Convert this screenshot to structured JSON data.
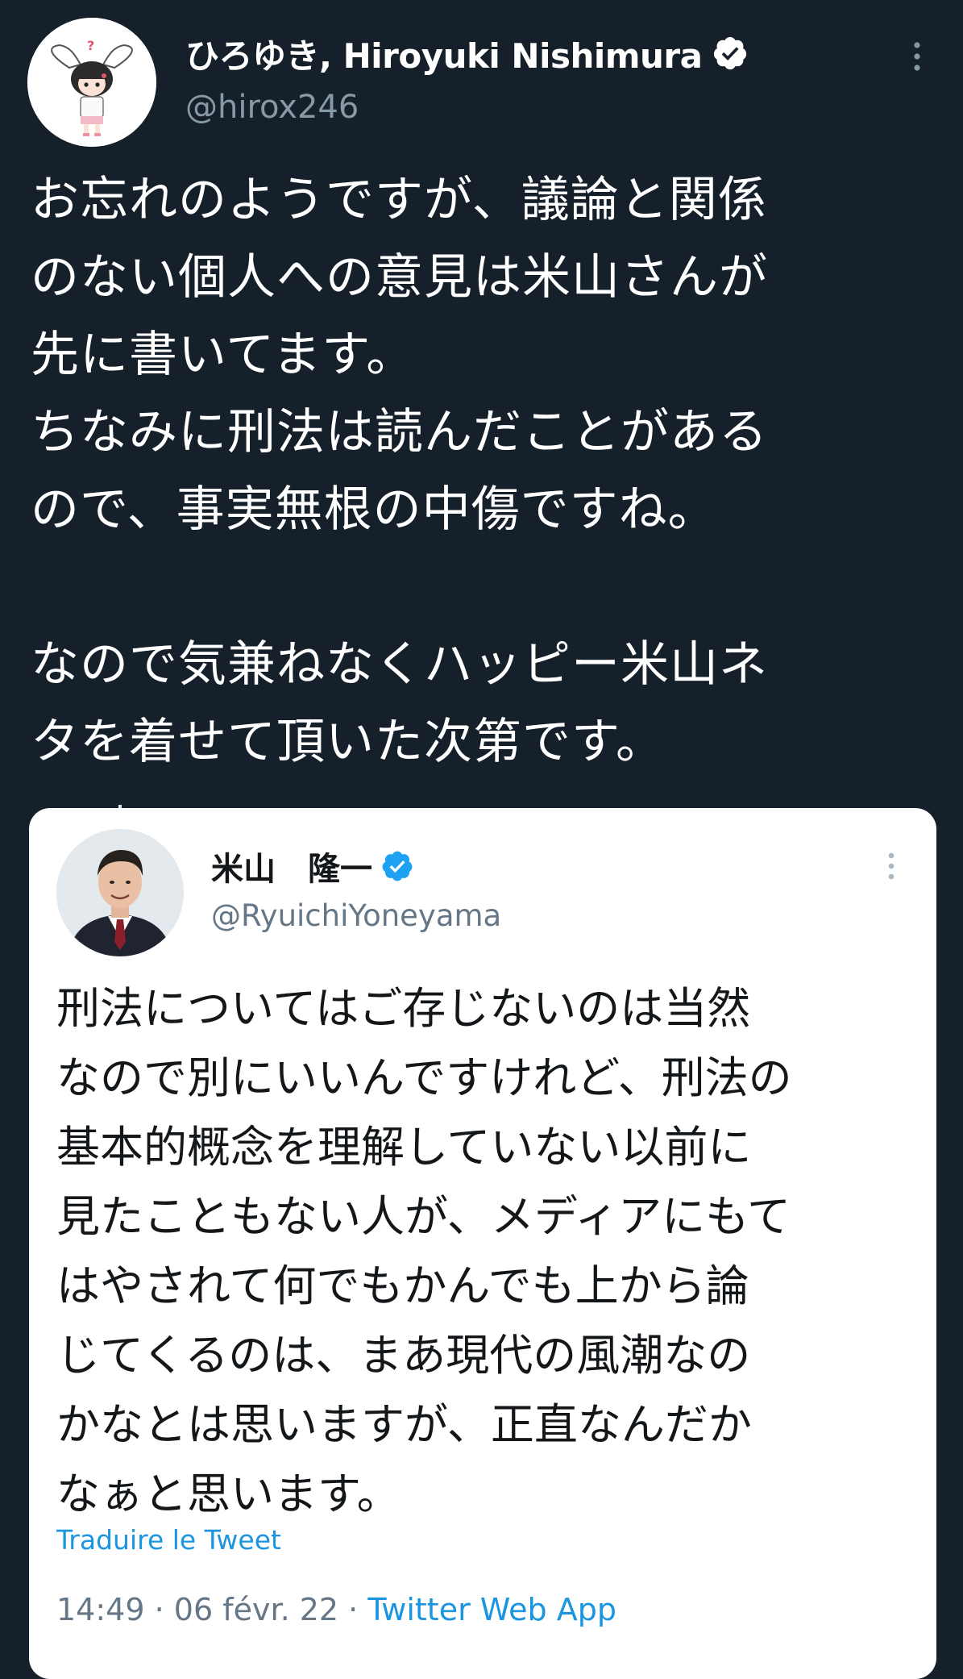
{
  "main_tweet": {
    "display_name": "ひろゆき, Hiroyuki Nishimura",
    "handle": "@hirox246",
    "text_lines": [
      "お忘れのようですが、議論と関係",
      "のない個人への意見は米山さんが",
      "先に書いてます。",
      "ちなみに刑法は読んだことがある",
      "ので、事実無根の中傷ですね。",
      "",
      "なので気兼ねなくハッピー米山ネ",
      "タを着せて頂いた次第です。"
    ]
  },
  "quoted_tweet": {
    "display_name": "米山　隆一",
    "handle": "@RyuichiYoneyama",
    "text_lines": [
      "刑法についてはご存じないのは当然",
      "なので別にいいんですけれど、刑法の",
      "基本的概念を理解していない以前に",
      "見たこともない人が、メディアにもて",
      "はやされて何でもかんでも上から論",
      "じてくるのは、まあ現代の風潮なの",
      "かなとは思いますが、正直なんだか",
      "なぁと思います。"
    ],
    "translate_label": "Traduire le Tweet",
    "time": "14:49",
    "separator": " · ",
    "date": "06 févr. 22",
    "source": "Twitter Web App"
  },
  "colors": {
    "background": "#15202b",
    "card": "#ffffff",
    "link": "#1b95e0",
    "verified": "#1da1f2",
    "muted_dark": "#8899a6",
    "muted_light": "#657786"
  },
  "icons": {
    "verified": "verified-badge-icon",
    "more": "more-vertical-icon"
  }
}
